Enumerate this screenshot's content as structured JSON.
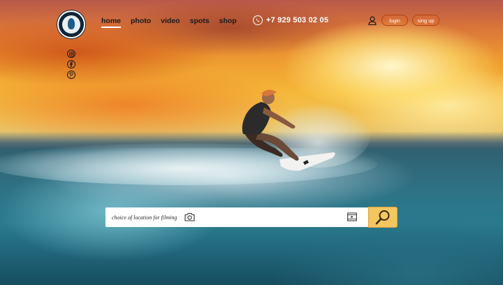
{
  "nav": {
    "items": [
      {
        "id": "home",
        "label": "home",
        "active": true
      },
      {
        "id": "photo",
        "label": "photo",
        "active": false
      },
      {
        "id": "video",
        "label": "video",
        "active": false
      },
      {
        "id": "spots",
        "label": "spots",
        "active": false
      },
      {
        "id": "shop",
        "label": "shop",
        "active": false
      }
    ]
  },
  "header": {
    "phone": "+7 929 503 02 05",
    "login_label": "login",
    "signup_label": "sing up"
  },
  "social": [
    "instagram-icon",
    "facebook-icon",
    "pinterest-icon"
  ],
  "search": {
    "placeholder": "choice of location for filming",
    "value": ""
  },
  "colors": {
    "accent": "#f3c660",
    "pill_border": "#b3410f",
    "nav_text": "#1a1a1a"
  }
}
